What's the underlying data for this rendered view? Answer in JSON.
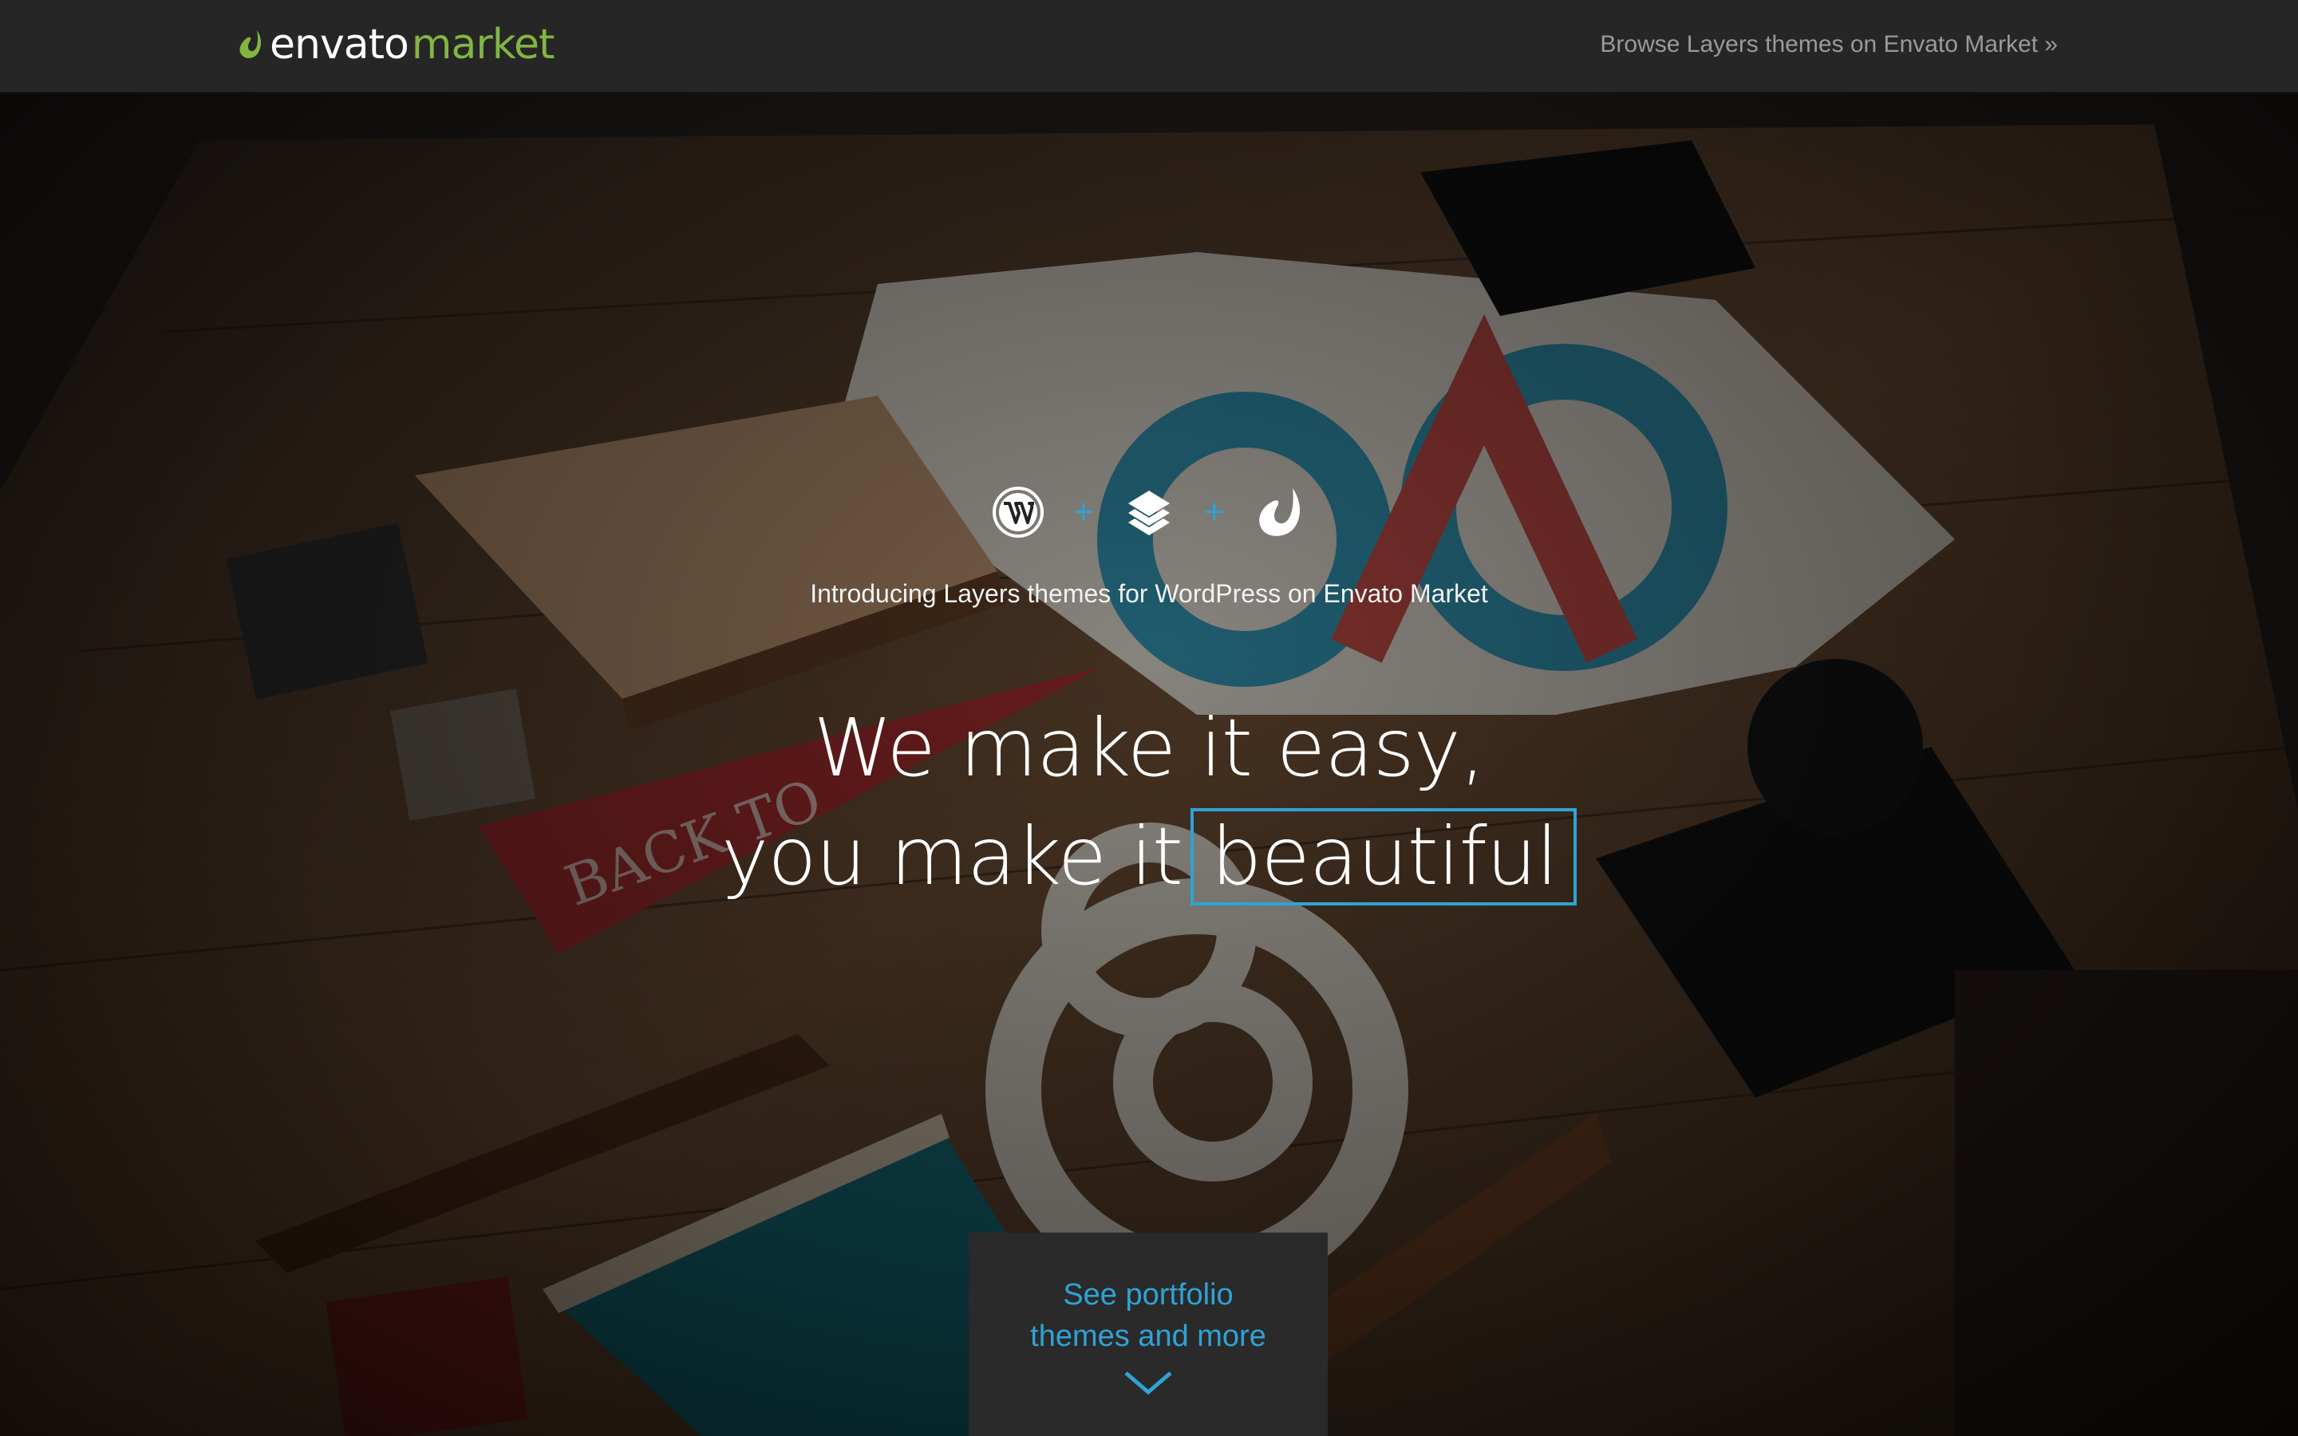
{
  "header": {
    "logo_envato": "envato",
    "logo_market": "market",
    "browse_link": "Browse Layers themes on Envato Market »"
  },
  "hero": {
    "icons": [
      "wordpress-icon",
      "layers-icon",
      "envato-leaf-icon"
    ],
    "plus_sign": "+",
    "intro": "Introducing Layers themes for WordPress on Envato Market",
    "headline_line1": "We make it easy,",
    "headline_line2_prefix": "you make it",
    "headline_highlight": "beautiful"
  },
  "cta": {
    "line1": "See portfolio",
    "line2": "themes and more"
  },
  "colors": {
    "accent": "#2ea3d6",
    "brand_green": "#82b541",
    "topbar_bg": "#262626",
    "cta_bg": "#2a2a2a"
  }
}
